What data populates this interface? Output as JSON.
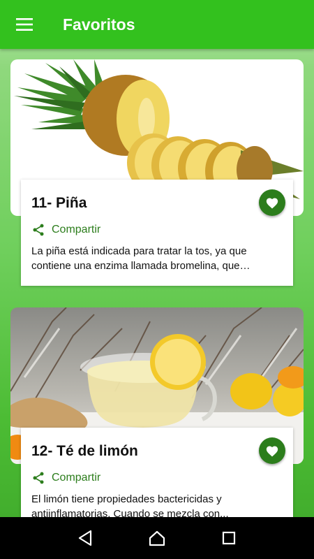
{
  "appbar": {
    "title": "Favoritos",
    "menu_icon": "hamburger-menu-icon",
    "color": "#33c11e"
  },
  "cards": [
    {
      "title": "11- Piña",
      "share_label": "Compartir",
      "description": "La piña está indicada para tratar la tos, ya que contiene una enzima llamada bromelina, que…",
      "image": "pineapple-photo",
      "favorite": true
    },
    {
      "title": "12- Té de limón",
      "share_label": "Compartir",
      "description": "El limón tiene propiedades bactericidas y antiinflamatorias. Cuando se mezcla con...",
      "image": "lemon-tea-photo",
      "favorite": true
    }
  ],
  "colors": {
    "accent": "#2c7d1c",
    "heart": "#2c7d1c"
  },
  "navbar": {
    "back_icon": "back-triangle-icon",
    "home_icon": "home-icon",
    "recents_icon": "recents-square-icon"
  }
}
